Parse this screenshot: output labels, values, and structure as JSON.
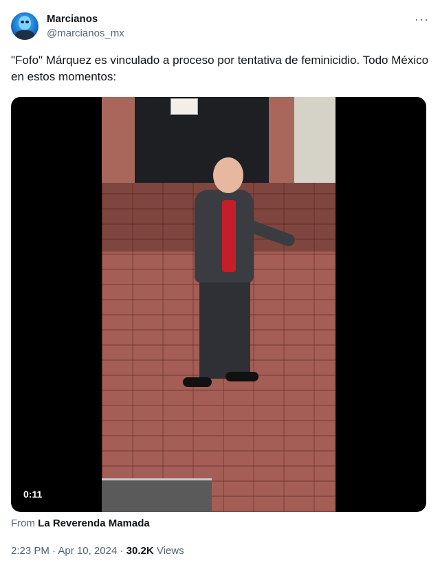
{
  "author": {
    "name": "Marcianos",
    "handle": "@marcianos_mx",
    "avatar_icon": "alien-avatar-icon"
  },
  "more_icon": "···",
  "tweet": {
    "text": "\"Fofo\" Márquez es vinculado a proceso por tentativa de feminicidio. Todo México en estos momentos:"
  },
  "media": {
    "duration": "0:11"
  },
  "attribution": {
    "prefix": "From",
    "source": "La Reverenda Mamada"
  },
  "meta": {
    "time": "2:23 PM",
    "separator1": "·",
    "date": "Apr 10, 2024",
    "separator2": "·",
    "views_count": "30.2K",
    "views_label": "Views"
  },
  "colors": {
    "secondary_text": "#536471",
    "primary_text": "#0f1419"
  }
}
